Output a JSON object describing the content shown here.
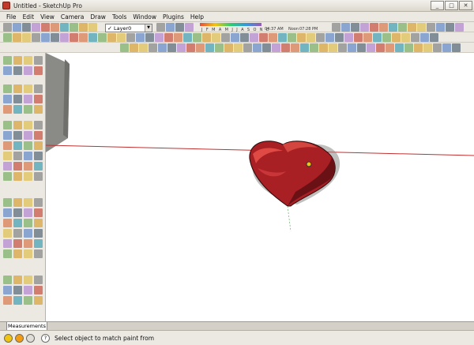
{
  "window": {
    "title": "Untitled - SketchUp Pro",
    "minimize": "_",
    "maximize": "□",
    "close": "✕"
  },
  "menu": [
    "File",
    "Edit",
    "View",
    "Camera",
    "Draw",
    "Tools",
    "Window",
    "Plugins",
    "Help"
  ],
  "layers": {
    "check": "✓",
    "current": "Layer0",
    "arrow": "▼"
  },
  "shadow": {
    "months": "J F M A M J J A S O N D",
    "time1": "04:37 AM",
    "noon": "Noon",
    "time2": "07:28 PM"
  },
  "tabs": {
    "measurements": "Measurements"
  },
  "status": {
    "hint": "Select object to match paint from",
    "icon_help": "?"
  },
  "colors": {
    "heart_main": "#a81f24",
    "heart_dark": "#6a1116",
    "heart_light": "#e04a44",
    "axis_red": "#c03030",
    "axis_green": "#4aa04a"
  }
}
